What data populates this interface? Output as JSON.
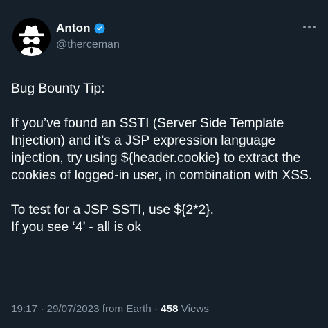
{
  "author": {
    "display_name": "Anton",
    "handle": "@therceman",
    "verified": true,
    "avatar_icon": "spy-incognito-icon"
  },
  "menu_icon": "more-options-icon",
  "tweet": {
    "text": "Bug Bounty Tip:\n\nIf you’ve found an SSTI (Server Side Template Injection) and it’s a JSP expression language injection, try using ${header.cookie} to extract the cookies of logged-in user, in combination with XSS.\n\nTo test for a JSP SSTI, use ${2*2}.\nIf you see ‘4’ - all is ok"
  },
  "meta": {
    "time": "19:17",
    "separator_1": " · ",
    "date": "29/07/2023",
    "source": " from Earth",
    "separator_2": " · ",
    "views_count": "458",
    "views_label": " Views"
  },
  "colors": {
    "background": "#15202b",
    "primary_text": "#f7f9f9",
    "secondary_text": "#8b98a5",
    "verified_badge": "#1d9bf0"
  }
}
